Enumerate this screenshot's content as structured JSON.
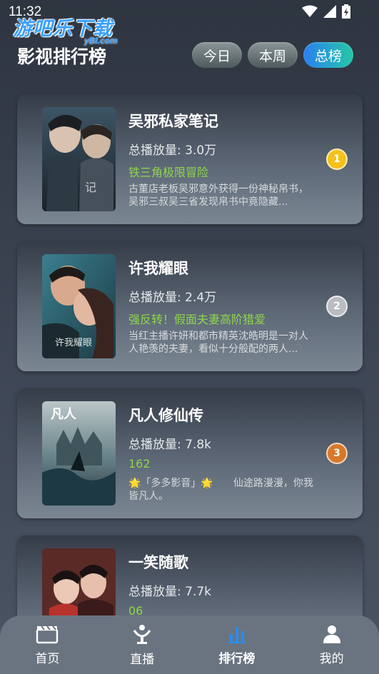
{
  "status_bar": {
    "time": "11:32"
  },
  "watermark": {
    "logo_text": "游吧乐下载",
    "site": "yBl.com"
  },
  "header": {
    "title": "影视排行榜"
  },
  "tabs": [
    {
      "label": "今日",
      "active": false
    },
    {
      "label": "本周",
      "active": false
    },
    {
      "label": "总榜",
      "active": true
    }
  ],
  "items": [
    {
      "title": "吴邪私家笔记",
      "plays": "总播放量: 3.0万",
      "tag": "铁三角极限冒险",
      "description": "古董店老板吴邪意外获得一份神秘帛书，吴邪三叔吴三省发现帛书中竟隐藏...",
      "rank": "1",
      "rank_color": "#f5c21b"
    },
    {
      "title": "许我耀眼",
      "plays": "总播放量: 2.4万",
      "tag": "强反转！假面夫妻高阶猎爱",
      "description": "当红主播许妍和都市精英沈皓明是一对人人艳羡的夫妻，看似十分般配的两人...",
      "rank": "2",
      "rank_color": "#b9bcc0"
    },
    {
      "title": "凡人修仙传",
      "plays": "总播放量: 7.8k",
      "tag": "162",
      "description": "🌟「多多影音」🌟　　仙途路漫漫，你我皆凡人。",
      "rank": "3",
      "rank_color": "#d7782a"
    },
    {
      "title": "一笑随歌",
      "plays": "总播放量: 7.7k",
      "tag": "06",
      "description": "",
      "rank": "",
      "rank_color": "#7a8792"
    }
  ],
  "bottom_nav": [
    {
      "label": "首页",
      "icon": "clapperboard-icon",
      "active": false
    },
    {
      "label": "直播",
      "icon": "live-stand-icon",
      "active": false
    },
    {
      "label": "排行榜",
      "icon": "bar-chart-icon",
      "active": true
    },
    {
      "label": "我的",
      "icon": "person-icon",
      "active": false
    }
  ]
}
